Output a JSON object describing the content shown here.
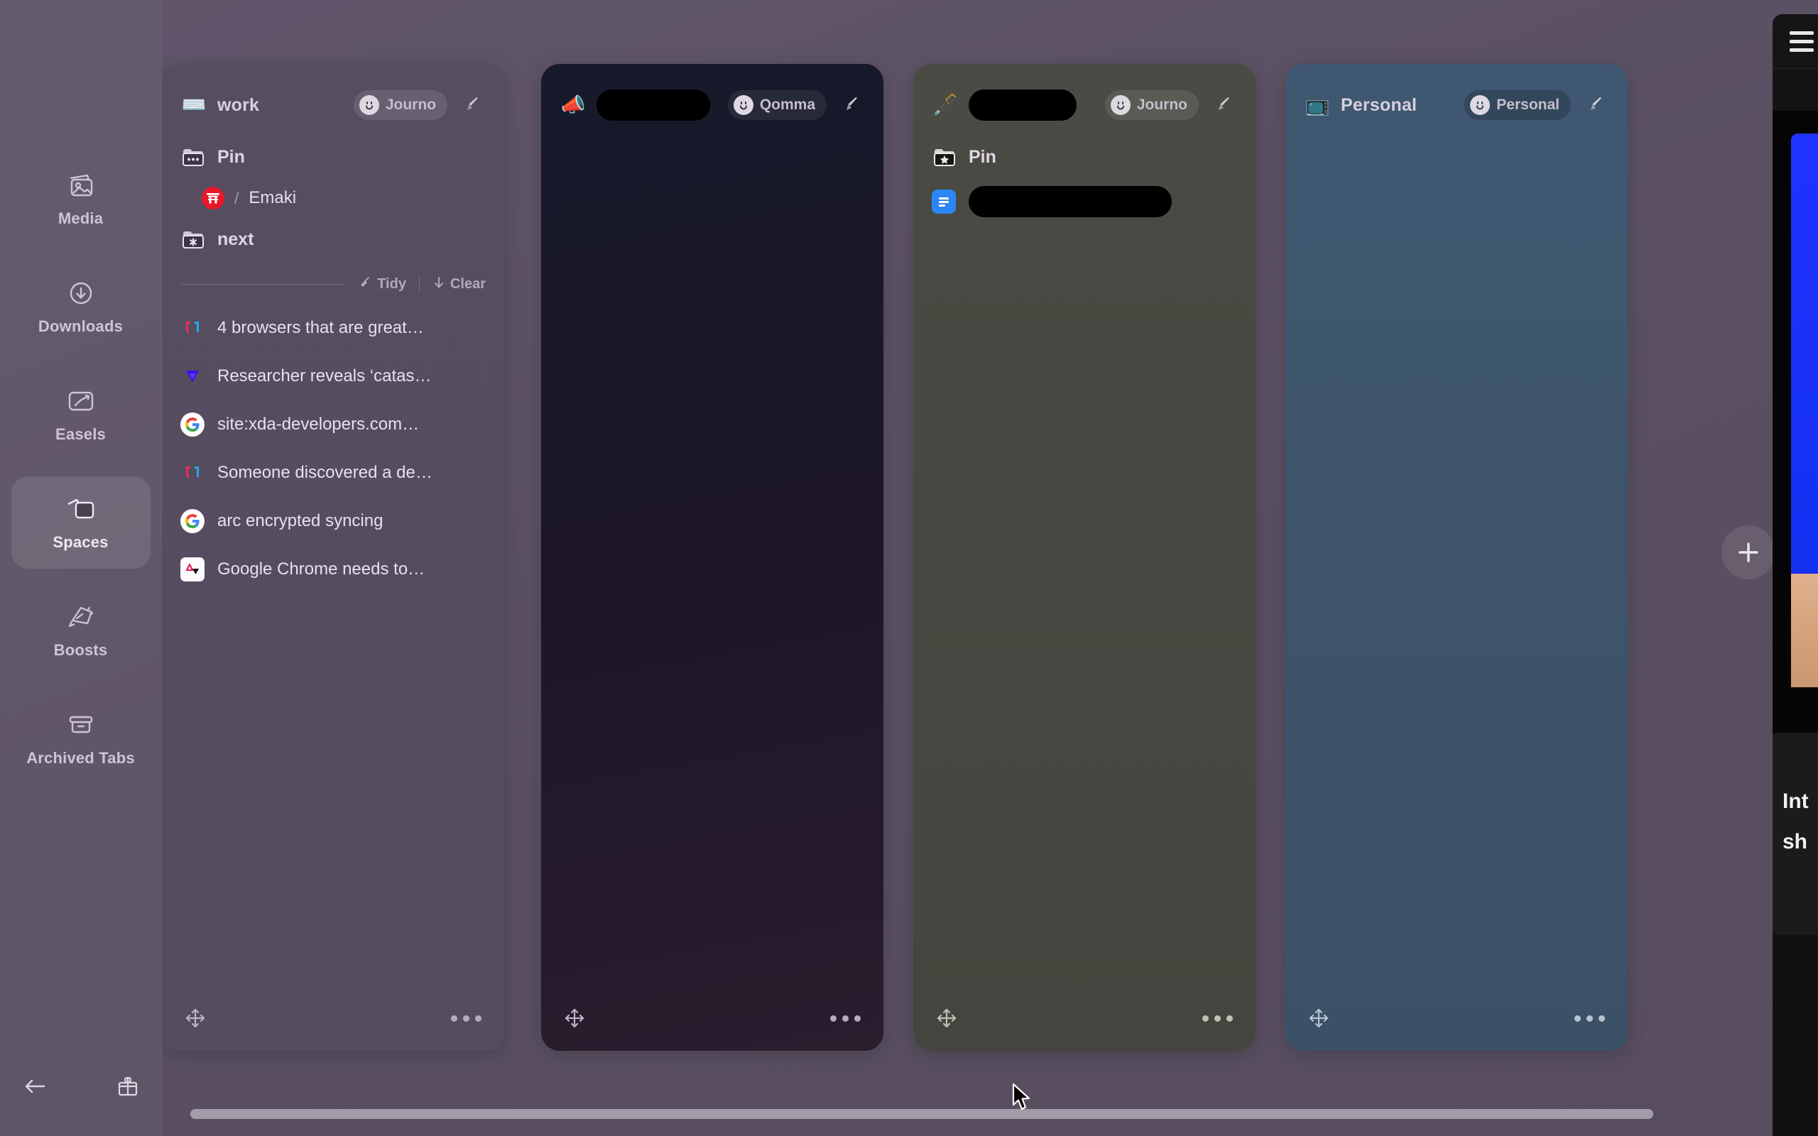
{
  "app": {
    "accent": "#5a4f61",
    "board_bg": "#574d5e"
  },
  "sidebar": {
    "items": [
      {
        "label": "Media",
        "icon": "media-icon",
        "active": false
      },
      {
        "label": "Downloads",
        "icon": "download-icon",
        "active": false
      },
      {
        "label": "Easels",
        "icon": "easel-icon",
        "active": false
      },
      {
        "label": "Spaces",
        "icon": "spaces-icon",
        "active": true
      },
      {
        "label": "Boosts",
        "icon": "boost-icon",
        "active": false
      },
      {
        "label": "Archived Tabs",
        "icon": "archive-icon",
        "active": false
      }
    ],
    "footer": {
      "back_icon": "back-arrow-icon",
      "gift_icon": "gift-icon"
    }
  },
  "board": {
    "add_space_label": "+",
    "cards": [
      {
        "id": "card-work",
        "emoji": "⌨️",
        "title": "work",
        "title_redacted": false,
        "profile": "Journo",
        "brush_icon": "paintbrush-icon",
        "folders": [
          {
            "label": "Pin",
            "icon": "folder-dots-icon"
          },
          {
            "label": "next",
            "icon": "folder-asterisk-icon"
          }
        ],
        "child": {
          "favicon": "torii-shrine-icon",
          "separator": "/",
          "label": "Emaki"
        },
        "tidy": {
          "tidy_label": "Tidy",
          "clear_label": "Clear",
          "tidy_icon": "broom-icon",
          "clear_icon": "down-arrow-icon"
        },
        "tabs": [
          {
            "favicon": "xda-icon",
            "title": "4 browsers that are great…"
          },
          {
            "favicon": "vercel-icon",
            "title": "Researcher reveals ‘catas…"
          },
          {
            "favicon": "google-icon",
            "title": "site:xda-developers.com…"
          },
          {
            "favicon": "xda-icon",
            "title": "Someone discovered a de…"
          },
          {
            "favicon": "google-icon",
            "title": "arc encrypted syncing"
          },
          {
            "favicon": "androidauthority-icon",
            "title": "Google Chrome needs to…"
          }
        ],
        "footer": {
          "move_icon": "move-handle-icon",
          "more_icon": "more-options-icon"
        }
      },
      {
        "id": "card-qomma",
        "emoji": "📣",
        "title": "",
        "title_redacted": true,
        "profile": "Qomma",
        "brush_icon": "paintbrush-icon",
        "folders": [],
        "tabs": [],
        "footer": {
          "move_icon": "move-handle-icon",
          "more_icon": "more-options-icon"
        }
      },
      {
        "id": "card-journo",
        "emoji": "🖋️",
        "title": "",
        "title_redacted": true,
        "profile": "Journo",
        "brush_icon": "paintbrush-icon",
        "folders": [
          {
            "label": "Pin",
            "icon": "folder-star-icon"
          }
        ],
        "tabs": [
          {
            "favicon": "google-docs-icon",
            "title": "",
            "redacted": true
          }
        ],
        "footer": {
          "move_icon": "move-handle-icon",
          "more_icon": "more-options-icon"
        }
      },
      {
        "id": "card-personal",
        "emoji": "📺",
        "title": "Personal",
        "title_redacted": false,
        "profile": "Personal",
        "brush_icon": "paintbrush-icon",
        "folders": [],
        "tabs": [],
        "footer": {
          "move_icon": "move-handle-icon",
          "more_icon": "more-options-icon"
        }
      }
    ]
  },
  "right_window": {
    "hamburger_icon": "hamburger-menu-icon",
    "caption_line1": "Int",
    "caption_line2": "sh"
  },
  "scrollbar": {
    "orientation": "horizontal"
  }
}
